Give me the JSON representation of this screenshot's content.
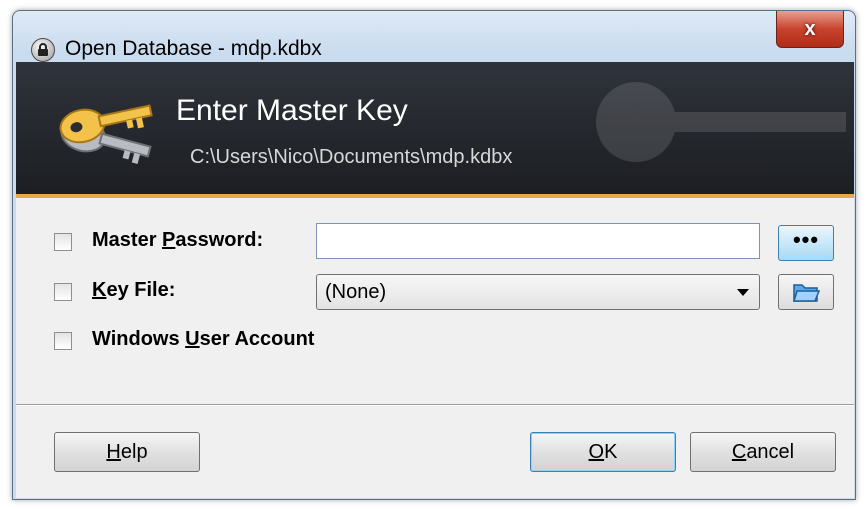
{
  "window": {
    "title": "Open Database - mdp.kdbx",
    "close_label": "x"
  },
  "header": {
    "title": "Enter Master Key",
    "path": "C:\\Users\\Nico\\Documents\\mdp.kdbx"
  },
  "form": {
    "master_password": {
      "label_before": "Master ",
      "label_accel": "P",
      "label_after": "assword:",
      "value": "",
      "reveal_label": "•••",
      "checked": false
    },
    "key_file": {
      "label_accel": "K",
      "label_after": "ey File:",
      "selected": "(None)",
      "checked": false
    },
    "windows_account": {
      "label_before": "Windows ",
      "label_accel": "U",
      "label_after": "ser Account",
      "checked": false
    }
  },
  "buttons": {
    "help": {
      "accel": "H",
      "rest": "elp"
    },
    "ok": {
      "accel": "O",
      "rest": "K"
    },
    "cancel": {
      "accel": "C",
      "rest": "ancel"
    }
  },
  "colors": {
    "header_bg": "#1c1e22",
    "header_accent": "#e8a848",
    "close_red": "#c7432d",
    "dialog_bg": "#f0f0f0"
  },
  "icons": {
    "title": "lock-icon",
    "header": "keys-icon",
    "reveal": "dots-icon",
    "browse": "folder-open-icon",
    "dropdown": "chevron-down-icon"
  }
}
